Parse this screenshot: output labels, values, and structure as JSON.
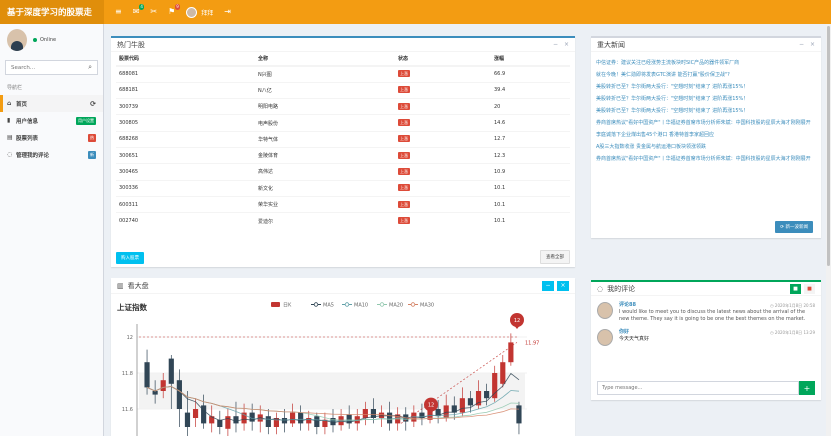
{
  "app": {
    "title": "基于深度学习的股票走",
    "user_name": "拜拜",
    "colors": {
      "accent": "#f39c12",
      "accent_dark": "#e08e0b",
      "blue": "#3c8dbc",
      "red": "#dd4b39",
      "green": "#00a65a",
      "cyan": "#00c0ef"
    }
  },
  "topbar": {
    "icons": [
      {
        "name": "menu-toggle-icon",
        "glyph": "≡"
      },
      {
        "name": "mail-icon",
        "glyph": "✉",
        "badge": "4",
        "badge_color": "#00a65a"
      },
      {
        "name": "bell-icon",
        "glyph": "✂",
        "badge": "",
        "badge_color": "#f39c12"
      },
      {
        "name": "flag-icon",
        "glyph": "⚑",
        "badge": "9",
        "badge_color": "#dd4b39"
      }
    ],
    "settings_glyph": "⇥"
  },
  "sidebar": {
    "status": "Online",
    "search_placeholder": "Search...",
    "search_icon": "⌕",
    "header": "导航栏",
    "items": [
      {
        "icon": "home-icon",
        "glyph": "⌂",
        "label": "首页",
        "badge": "",
        "badge_color": "",
        "right_glyph": "⟳"
      },
      {
        "icon": "user-icon",
        "glyph": "▮",
        "label": "用户信息",
        "badge": "用户设置",
        "badge_color": "#00a65a",
        "right_glyph": ""
      },
      {
        "icon": "list-icon",
        "glyph": "▤",
        "label": "股票列表",
        "badge": "热",
        "badge_color": "#dd4b39",
        "right_glyph": ""
      },
      {
        "icon": "comment-icon",
        "glyph": "◌",
        "label": "管理我的评论",
        "badge": "新",
        "badge_color": "#3c8dbc",
        "right_glyph": ""
      }
    ]
  },
  "hot_stocks": {
    "title": "热门牛股",
    "columns": [
      "股票代码",
      "全称",
      "状态",
      "涨幅"
    ],
    "rows": [
      [
        "688081",
        "N兴图",
        "上涨",
        "66.9"
      ],
      [
        "688181",
        "N八亿",
        "上涨",
        "39.4"
      ],
      [
        "300739",
        "明阳电路",
        "上涨",
        "20"
      ],
      [
        "300805",
        "电声股份",
        "上涨",
        "14.6"
      ],
      [
        "688268",
        "华特气体",
        "上涨",
        "12.7"
      ],
      [
        "300651",
        "金陵体育",
        "上涨",
        "12.3"
      ],
      [
        "300465",
        "高伟达",
        "上涨",
        "10.9"
      ],
      [
        "300336",
        "新文化",
        "上涨",
        "10.1"
      ],
      [
        "600311",
        "荣华实业",
        "上涨",
        "10.1"
      ],
      [
        "002740",
        "爱迪尔",
        "上涨",
        "10.1"
      ]
    ],
    "buy_label": "购入股票",
    "view_all_label": "查看全部"
  },
  "news": {
    "title": "重大新闻",
    "items": [
      "中信证券：建议关注已经涨势主流板块时SIC产品的器件领军厂商",
      "就在今晚！美仁勋即将发表GTC演讲 能否打赢\"股价保卫战\"?",
      "美股转折已至？华尔街两大投行：\"空翘时刻\"结束了 进阶再涨15%！",
      "美股转折已至？华尔街两大投行：\"空翘时刻\"结束了 进阶再涨15%！",
      "美股转折已至？华尔街两大投行：\"空翘时刻\"结束了 进阶再涨15%！",
      "券商首席热议\"看好中国资产\"丨华福证券首席市场分析师朱斌：中国科技股的星辰大海才刚刚展开",
      "李庭诚落下企业煤出售45个港口 香港特首李家超回应",
      "A股三大指数收涨 贵金属与航运港口板块领涨领跌",
      "券商首席热议\"看好中国资产\"丨华福证券首席市场分析师朱斌：中国科技股的星辰大海才刚刚展开"
    ],
    "more_label": "新一波新闻"
  },
  "kline": {
    "title": "看大盘",
    "subtitle": "上证指数",
    "legend": [
      "日K",
      "MA5",
      "MA10",
      "MA20",
      "MA30"
    ],
    "legend_colors": [
      "#c23531",
      "#2f4554",
      "#61a0a8",
      "#91c7ae",
      "#d48265"
    ],
    "ymax_label": "12",
    "y_ticks": [
      "12",
      "11.8",
      "11.6"
    ],
    "markers": [
      {
        "label": "12",
        "value": 12.05
      },
      {
        "label": "12",
        "value": 11.58
      }
    ],
    "last_label": "11.97"
  },
  "chart_data": {
    "type": "candlestick",
    "title": "上证指数",
    "legend": [
      "日K",
      "MA5",
      "MA10",
      "MA20",
      "MA30"
    ],
    "ylim": [
      11.45,
      12.05
    ],
    "y_ticks": [
      12,
      11.8,
      11.6
    ],
    "candles": [
      [
        11.86,
        11.72,
        11.93,
        11.68
      ],
      [
        11.7,
        11.68,
        11.76,
        11.63
      ],
      [
        11.7,
        11.76,
        11.8,
        11.66
      ],
      [
        11.88,
        11.74,
        11.9,
        11.6
      ],
      [
        11.76,
        11.6,
        11.82,
        11.5
      ],
      [
        11.58,
        11.5,
        11.7,
        11.45
      ],
      [
        11.55,
        11.6,
        11.66,
        11.5
      ],
      [
        11.62,
        11.52,
        11.68,
        11.49
      ],
      [
        11.52,
        11.56,
        11.62,
        11.47
      ],
      [
        11.54,
        11.5,
        11.59,
        11.46
      ],
      [
        11.49,
        11.56,
        11.6,
        11.45
      ],
      [
        11.56,
        11.52,
        11.64,
        11.47
      ],
      [
        11.52,
        11.58,
        11.63,
        11.48
      ],
      [
        11.58,
        11.53,
        11.63,
        11.48
      ],
      [
        11.53,
        11.57,
        11.62,
        11.47
      ],
      [
        11.56,
        11.5,
        11.6,
        11.46
      ],
      [
        11.5,
        11.55,
        11.58,
        11.46
      ],
      [
        11.55,
        11.52,
        11.6,
        11.47
      ],
      [
        11.52,
        11.58,
        11.63,
        11.5
      ],
      [
        11.58,
        11.52,
        11.62,
        11.48
      ],
      [
        11.52,
        11.55,
        11.59,
        11.48
      ],
      [
        11.56,
        11.5,
        11.58,
        11.46
      ],
      [
        11.5,
        11.54,
        11.58,
        11.46
      ],
      [
        11.55,
        11.51,
        11.6,
        11.47
      ],
      [
        11.51,
        11.56,
        11.6,
        11.48
      ],
      [
        11.57,
        11.52,
        11.62,
        11.49
      ],
      [
        11.52,
        11.56,
        11.6,
        11.48
      ],
      [
        11.55,
        11.6,
        11.64,
        11.51
      ],
      [
        11.6,
        11.55,
        11.66,
        11.52
      ],
      [
        11.55,
        11.58,
        11.62,
        11.5
      ],
      [
        11.58,
        11.52,
        11.64,
        11.48
      ],
      [
        11.52,
        11.57,
        11.61,
        11.48
      ],
      [
        11.57,
        11.53,
        11.61,
        11.48
      ],
      [
        11.53,
        11.58,
        11.62,
        11.5
      ],
      [
        11.58,
        11.55,
        11.63,
        11.51
      ],
      [
        11.54,
        11.6,
        11.66,
        11.52
      ],
      [
        11.6,
        11.56,
        11.65,
        11.52
      ],
      [
        11.55,
        11.62,
        11.68,
        11.53
      ],
      [
        11.62,
        11.58,
        11.67,
        11.54
      ],
      [
        11.58,
        11.66,
        11.72,
        11.56
      ],
      [
        11.66,
        11.62,
        11.7,
        11.58
      ],
      [
        11.62,
        11.7,
        11.76,
        11.6
      ],
      [
        11.7,
        11.66,
        11.74,
        11.62
      ],
      [
        11.66,
        11.8,
        11.84,
        11.64
      ],
      [
        11.74,
        11.86,
        11.9,
        11.72
      ],
      [
        11.86,
        11.97,
        12.02,
        11.84
      ],
      [
        11.62,
        11.52,
        11.64,
        11.46
      ]
    ]
  },
  "comments": {
    "title": "我的评论",
    "items": [
      {
        "name": "评论88",
        "time": "◷ 2020年1月8日 20:58",
        "text": "I would like to meet you to discuss the latest news about the arrival of the new theme. They say it is going to be one the best themes on the market."
      },
      {
        "name": "你好",
        "time": "◷ 2020年1月8日 13:29",
        "text": "今天天气真好"
      }
    ],
    "input_placeholder": "Type message...",
    "send_glyph": "+"
  }
}
